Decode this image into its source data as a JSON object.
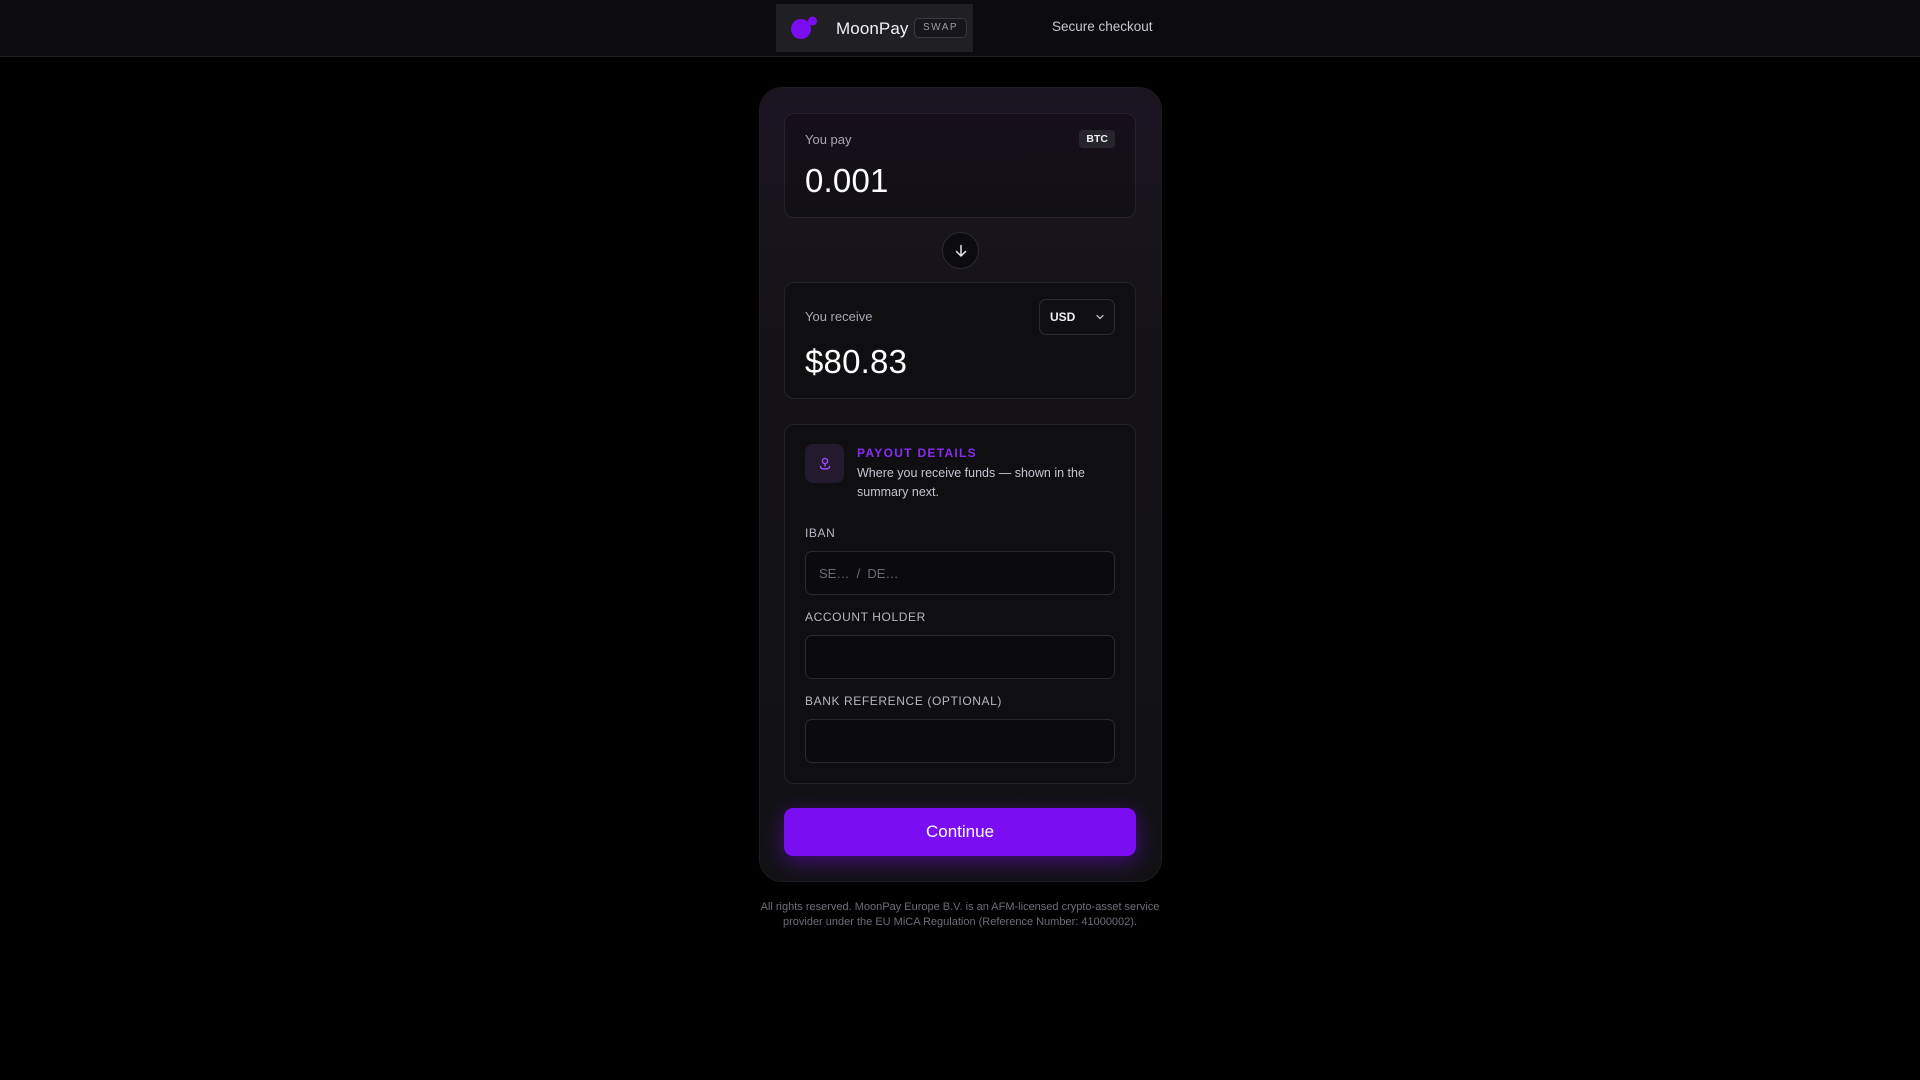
{
  "header": {
    "brand_name": "MoonPay",
    "brand_badge": "SWAP",
    "secure_text": "Secure checkout"
  },
  "pay": {
    "label": "You pay",
    "currency": "BTC",
    "amount": "0.001"
  },
  "receive": {
    "label": "You receive",
    "currency": "USD",
    "amount": "$80.83"
  },
  "payout": {
    "title": "PAYOUT DETAILS",
    "description": "Where you receive funds — shown in the summary next.",
    "iban_label": "IBAN",
    "iban_placeholder": "SE…  /  DE…",
    "iban_value": "",
    "holder_label": "ACCOUNT HOLDER",
    "holder_value": "",
    "reference_label": "BANK REFERENCE (OPTIONAL)",
    "reference_value": ""
  },
  "continue_label": "Continue",
  "footer_text": "All rights reserved. MoonPay Europe B.V. is an AFM-licensed crypto-asset service provider under the EU MiCA Regulation (Reference Number: 41000002).",
  "colors": {
    "accent": "#7a0df2",
    "accent_text": "#8a2bf0",
    "background": "#000000"
  },
  "icons": {
    "logo": "moonpay-logo",
    "swap": "arrow-down-icon",
    "select": "chevron-down-icon",
    "payout": "bank-pin-icon"
  }
}
